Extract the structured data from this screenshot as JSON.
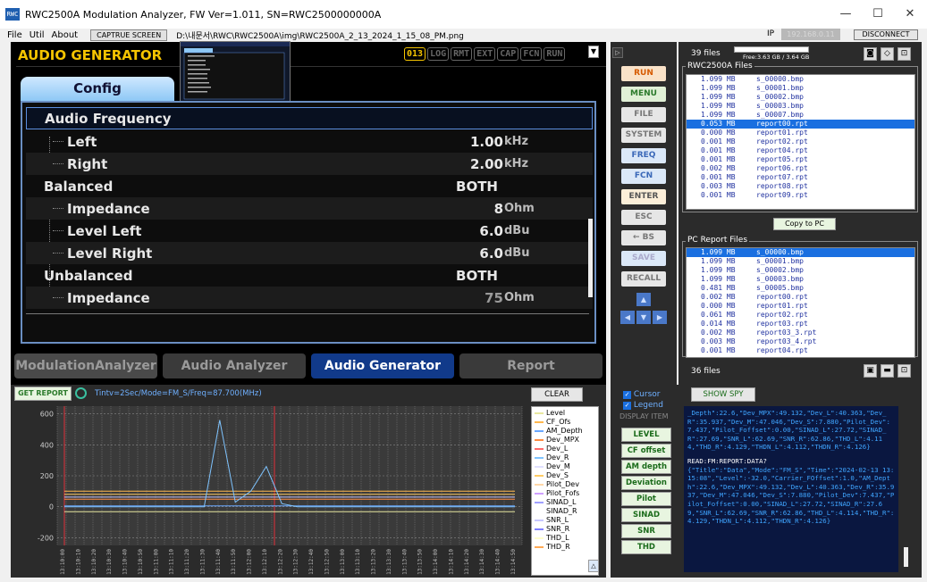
{
  "window": {
    "title": "RWC2500A Modulation Analyzer, FW Ver=1.011, SN=RWC2500000000A",
    "min": "—",
    "max": "☐",
    "close": "✕"
  },
  "menu": {
    "items": [
      "File",
      "Util",
      "About"
    ],
    "capture": "CAPTRUE SCREEN",
    "path": "D:\\내문서\\RWC\\RWC2500A\\img\\RWC2500A_2_13_2024_1_15_08_PM.png",
    "ip_label": "IP",
    "ip_value": "192.168.0.11",
    "disconnect": "DISCONNECT"
  },
  "generator": {
    "title": "AUDIO GENERATOR",
    "status": [
      "013",
      "LOG",
      "RMT",
      "EXT",
      "CAP",
      "FCN",
      "RUN"
    ],
    "tab": "Config",
    "rows": [
      {
        "label": "Audio Frequency",
        "value": "",
        "unit": "",
        "sub": false
      },
      {
        "label": "Left",
        "value": "1.00",
        "unit": "kHz",
        "sub": true
      },
      {
        "label": "Right",
        "value": "2.00",
        "unit": "kHz",
        "sub": true
      },
      {
        "label": "Balanced",
        "value": "BOTH",
        "unit": "",
        "sub": false
      },
      {
        "label": "Impedance",
        "value": "8",
        "unit": "Ohm",
        "sub": true
      },
      {
        "label": "Level Left",
        "value": "6.0",
        "unit": "dBu",
        "sub": true
      },
      {
        "label": "Level Right",
        "value": "6.0",
        "unit": "dBu",
        "sub": true
      },
      {
        "label": "Unbalanced",
        "value": "BOTH",
        "unit": "",
        "sub": false
      },
      {
        "label": "Impedance",
        "value": "75",
        "unit": "Ohm",
        "sub": true
      }
    ],
    "bottom_tabs": [
      "ModulationAnalyzer",
      "Audio Analyzer",
      "Audio Generator",
      "Report"
    ]
  },
  "midbuttons": [
    "RUN",
    "MENU",
    "FILE",
    "SYSTEM",
    "FREQ",
    "FCN",
    "ENTER",
    "ESC",
    "← BS",
    "SAVE",
    "RECALL"
  ],
  "files": {
    "count": "39 files",
    "free": "Free:3.63 GB / 3.64 GB",
    "group1": "RWC2500A Files",
    "list1": [
      [
        "1.099 MB",
        "s_00000.bmp"
      ],
      [
        "1.099 MB",
        "s_00001.bmp"
      ],
      [
        "1.099 MB",
        "s_00002.bmp"
      ],
      [
        "1.099 MB",
        "s_00003.bmp"
      ],
      [
        "1.099 MB",
        "s_00007.bmp"
      ],
      [
        "0.053 MB",
        "report00.rpt"
      ],
      [
        "0.000 MB",
        "report01.rpt"
      ],
      [
        "0.001 MB",
        "report02.rpt"
      ],
      [
        "0.001 MB",
        "report04.rpt"
      ],
      [
        "0.001 MB",
        "report05.rpt"
      ],
      [
        "0.002 MB",
        "report06.rpt"
      ],
      [
        "0.001 MB",
        "report07.rpt"
      ],
      [
        "0.003 MB",
        "report08.rpt"
      ],
      [
        "0.001 MB",
        "report09.rpt"
      ]
    ],
    "copy": "Copy to PC",
    "group2": "PC Report Files",
    "list2": [
      [
        "1.099 MB",
        "s_00000.bmp"
      ],
      [
        "1.099 MB",
        "s_00001.bmp"
      ],
      [
        "1.099 MB",
        "s_00002.bmp"
      ],
      [
        "1.099 MB",
        "s_00003.bmp"
      ],
      [
        "0.481 MB",
        "s_00005.bmp"
      ],
      [
        "0.002 MB",
        "report00.rpt"
      ],
      [
        "0.000 MB",
        "report01.rpt"
      ],
      [
        "0.061 MB",
        "report02.rpt"
      ],
      [
        "0.014 MB",
        "report03.rpt"
      ],
      [
        "0.002 MB",
        "report03_3.rpt"
      ],
      [
        "0.003 MB",
        "report03_4.rpt"
      ],
      [
        "0.001 MB",
        "report04.rpt"
      ]
    ],
    "count2": "36 files"
  },
  "report": {
    "get": "GET REPORT",
    "info": "Tintv=2Sec/Mode=FM_S/Freq=87.700(MHz)",
    "clear": "CLEAR",
    "cursor": "Cursor",
    "legend": "Legend",
    "display_item": "DISPLAY ITEM",
    "show_spy": "SHOW SPY",
    "items": [
      "LEVEL",
      "CF offset",
      "AM depth",
      "Deviation",
      "Pilot",
      "SINAD",
      "SNR",
      "THD"
    ],
    "spy1": "_Depth\":22.6,\"Dev_MPX\":49.132,\"Dev_L\":40.363,\"Dev_R\":35.937,\"Dev_M\":47.046,\"Dev_S\":7.880,\"Pilot_Dev\":7.437,\"Pilot_Foffset\":0.00,\"SINAD_L\":27.72,\"SINAD_R\":27.69,\"SNR_L\":62.69,\"SNR_R\":62.86,\"THD_L\":4.114,\"THD_R\":4.129,\"THDN_L\":4.112,\"THDN_R\":4.126}",
    "spy_cmd": "READ:FM:REPORT:DATA?",
    "spy2": "{\"Title\":\"Data\",\"Mode\":\"FM_S\",\"Time\":\"2024-02-13 13:15:08\",\"Level\":-32.0,\"Carrier_FOffset\":1.0,\"AM_Depth\":22.6,\"Dev_MPX\":49.132,\"Dev_L\":40.363,\"Dev_R\":35.937,\"Dev_M\":47.046,\"Dev_S\":7.880,\"Pilot_Dev\":7.437,\"Pilot_Foffset\":0.00,\"SINAD_L\":27.72,\"SINAD_R\":27.69,\"SNR_L\":62.69,\"SNR_R\":62.86,\"THD_L\":4.114,\"THD_R\":4.129,\"THDN_L\":4.112,\"THDN_R\":4.126}"
  },
  "chart_data": {
    "type": "line",
    "ylim": [
      -250,
      650
    ],
    "yticks": [
      "600",
      "400",
      "200",
      "0",
      "-200"
    ],
    "legend": [
      "Level",
      "CF_Ofs",
      "AM_Depth",
      "Dev_MPX",
      "Dev_L",
      "Dev_R",
      "Dev_M",
      "Dev_S",
      "Pilot_Dev",
      "Pilot_Fofs",
      "SINAD_L",
      "SINAD_R",
      "SNR_L",
      "SNR_R",
      "THD_L",
      "THD_R"
    ],
    "colors": [
      "#e8e8a0",
      "#ffb84d",
      "#6aa8ff",
      "#ff8c42",
      "#ff6b6b",
      "#7fc4ff",
      "#e0e0ff",
      "#ffcc66",
      "#ffd8a8",
      "#d0a0ff",
      "#a0a0ff",
      "#ffffff",
      "#c8c8ff",
      "#8080ff",
      "#ffffcc",
      "#ffaa55"
    ],
    "series": [
      {
        "name": "Level",
        "values": [
          -32,
          -32,
          -32,
          -32,
          -32,
          -32,
          -32,
          -32,
          -32,
          -32,
          -32,
          -32,
          -32,
          -32,
          -32,
          -32,
          -32,
          -32,
          -32,
          -32,
          -32,
          -32,
          -32,
          -32,
          -32,
          -32,
          -32,
          -32,
          -32,
          -32
        ]
      },
      {
        "name": "Dev_MPX",
        "values": [
          49,
          49,
          49,
          49,
          49,
          49,
          49,
          49,
          49,
          49,
          49,
          49,
          49,
          49,
          49,
          49,
          49,
          49,
          49,
          49,
          49,
          49,
          49,
          49,
          49,
          49,
          49,
          49,
          49,
          49
        ]
      },
      {
        "name": "SNR_L",
        "values": [
          62,
          62,
          62,
          62,
          62,
          62,
          62,
          62,
          62,
          62,
          62,
          62,
          62,
          62,
          62,
          62,
          62,
          62,
          62,
          62,
          62,
          62,
          62,
          62,
          62,
          62,
          62,
          62,
          62,
          62
        ]
      },
      {
        "name": "AM_Depth",
        "values": [
          5,
          5,
          5,
          5,
          5,
          5,
          5,
          5,
          5,
          5,
          5,
          5,
          5,
          5,
          5,
          5,
          5,
          5,
          5,
          5,
          5,
          5,
          5,
          5,
          5,
          5,
          5,
          5,
          5,
          5
        ]
      },
      {
        "name": "Dev_S",
        "values": [
          80,
          80,
          80,
          80,
          80,
          80,
          80,
          80,
          80,
          80,
          80,
          80,
          80,
          80,
          80,
          80,
          80,
          80,
          80,
          80,
          80,
          80,
          80,
          80,
          80,
          80,
          80,
          80,
          80,
          80
        ]
      }
    ],
    "spike_series": [
      {
        "name": "CF_Ofs",
        "values": [
          100,
          100,
          100,
          100,
          100,
          100,
          100,
          100,
          100,
          100,
          100,
          100,
          100,
          100,
          100,
          100,
          100,
          100,
          100,
          100,
          100,
          100,
          100,
          100,
          100,
          100,
          100,
          100,
          100,
          100
        ]
      },
      {
        "name": "Dev_R",
        "values": [
          0,
          0,
          0,
          0,
          0,
          0,
          0,
          0,
          0,
          0,
          560,
          30,
          100,
          260,
          20,
          0,
          0,
          0,
          0,
          0,
          0,
          0,
          0,
          0,
          0,
          0,
          0,
          0,
          0,
          0
        ]
      }
    ]
  }
}
